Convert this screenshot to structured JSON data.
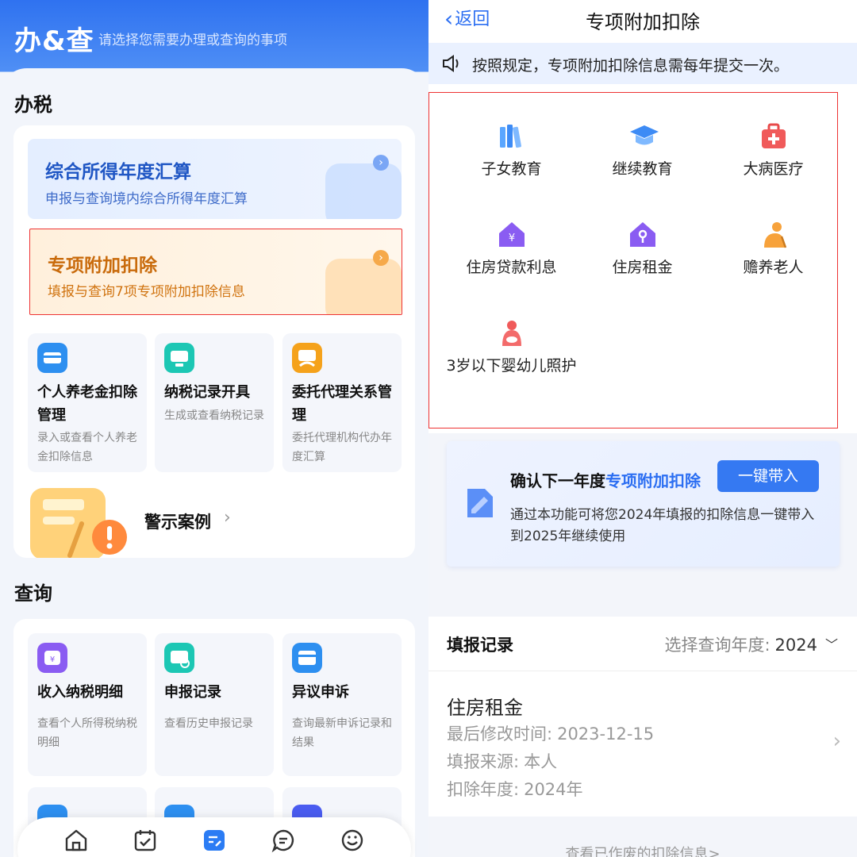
{
  "left": {
    "app_logo": "办&查",
    "subtitle": "请选择您需要办理或查询的事项",
    "tax_section": "办税",
    "query_section": "查询",
    "banners": [
      {
        "title": "综合所得年度汇算",
        "desc": "申报与查询境内综合所得年度汇算"
      },
      {
        "title": "专项附加扣除",
        "desc": "填报与查询7项专项附加扣除信息"
      }
    ],
    "tax_tiles": [
      {
        "title": "个人养老金扣除管理",
        "desc": "录入或查看个人养老金扣除信息",
        "icon": "pension-icon"
      },
      {
        "title": "纳税记录开具",
        "desc": "生成或查看纳税记录",
        "icon": "tax-record-icon"
      },
      {
        "title": "委托代理关系管理",
        "desc": "委托代理机构代办年度汇算",
        "icon": "agent-icon"
      }
    ],
    "warning_label": "警示案例",
    "query_tiles": [
      {
        "title": "收入纳税明细",
        "desc": "查看个人所得税纳税明细",
        "icon": "income-icon"
      },
      {
        "title": "申报记录",
        "desc": "查看历史申报记录",
        "icon": "declaration-icon"
      },
      {
        "title": "异议申诉",
        "desc": "查询最新申诉记录和结果",
        "icon": "appeal-icon"
      }
    ],
    "tabbar_icons": [
      "home-icon",
      "calendar-check-icon",
      "task-icon",
      "message-icon",
      "smile-icon"
    ]
  },
  "right": {
    "back_label": "返回",
    "title": "专项附加扣除",
    "notice": "按照规定，专项附加扣除信息需每年提交一次。",
    "items": [
      {
        "label": "子女教育",
        "icon": "books-icon"
      },
      {
        "label": "继续教育",
        "icon": "graduation-cap-icon"
      },
      {
        "label": "大病医疗",
        "icon": "medical-kit-icon"
      },
      {
        "label": "住房贷款利息",
        "icon": "house-loan-icon"
      },
      {
        "label": "住房租金",
        "icon": "house-rent-icon"
      },
      {
        "label": "赡养老人",
        "icon": "elderly-icon"
      },
      {
        "label": "3岁以下婴幼儿照护",
        "icon": "infant-care-icon"
      }
    ],
    "confirm": {
      "title_prefix": "确认下一年度",
      "title_highlight": "专项附加扣除",
      "button": "一键带入",
      "desc": "通过本功能可将您2024年填报的扣除信息一键带入到2025年继续使用"
    },
    "records": {
      "heading": "填报记录",
      "year_label": "选择查询年度:",
      "year_value": "2024",
      "item_name": "住房租金",
      "modified_label": "最后修改时间:",
      "modified_value": "2023-12-15",
      "source_label": "填报来源:",
      "source_value": "本人",
      "year_deduct_label": "扣除年度:",
      "year_deduct_value": "2024年"
    },
    "more_link": "查看已作废的扣除信息>"
  },
  "colors": {
    "brand_blue": "#2b6ef2",
    "highlight_red": "#e33333",
    "banner_blue_bg": "#e7f0ff",
    "banner_orange_bg": "#fff1dc",
    "banner_orange_text": "#d0730f"
  }
}
